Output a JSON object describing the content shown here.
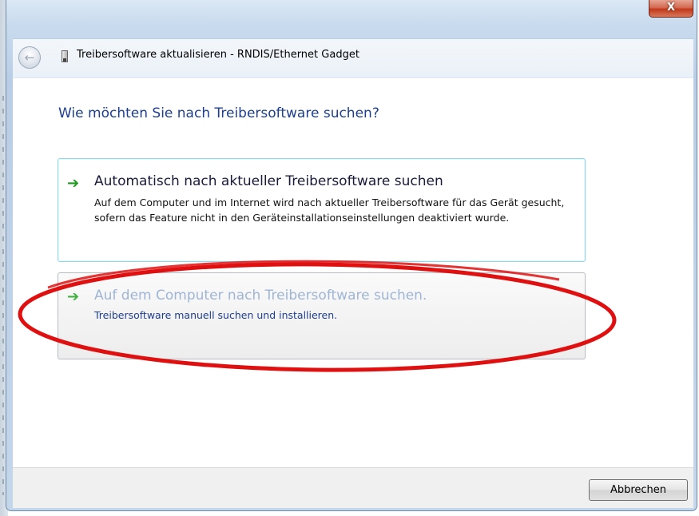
{
  "window": {
    "title": "Treibersoftware aktualisieren - RNDIS/Ethernet Gadget",
    "close_glyph": "X"
  },
  "header": {
    "back_glyph": "←",
    "back_icon": "back-arrow-icon",
    "device_icon": "usb-device-icon"
  },
  "main": {
    "heading": "Wie möchten Sie nach Treibersoftware suchen?",
    "options": [
      {
        "title": "Automatisch nach aktueller Treibersoftware suchen",
        "description": "Auf dem Computer und im Internet wird nach aktueller Treibersoftware für das Gerät gesucht, sofern das Feature nicht in den Geräteinstallationseinstellungen deaktiviert wurde.",
        "arrow_glyph": "➔",
        "icon": "green-arrow-icon"
      },
      {
        "title": "Auf dem Computer nach Treibersoftware suchen.",
        "description": "Treibersoftware manuell suchen und installieren.",
        "arrow_glyph": "➔",
        "icon": "green-arrow-icon"
      }
    ]
  },
  "footer": {
    "cancel_label": "Abbrechen"
  },
  "colors": {
    "heading": "#1e3e8f",
    "highlight_ellipse": "#e01010",
    "arrow": "#1e9a1e"
  }
}
